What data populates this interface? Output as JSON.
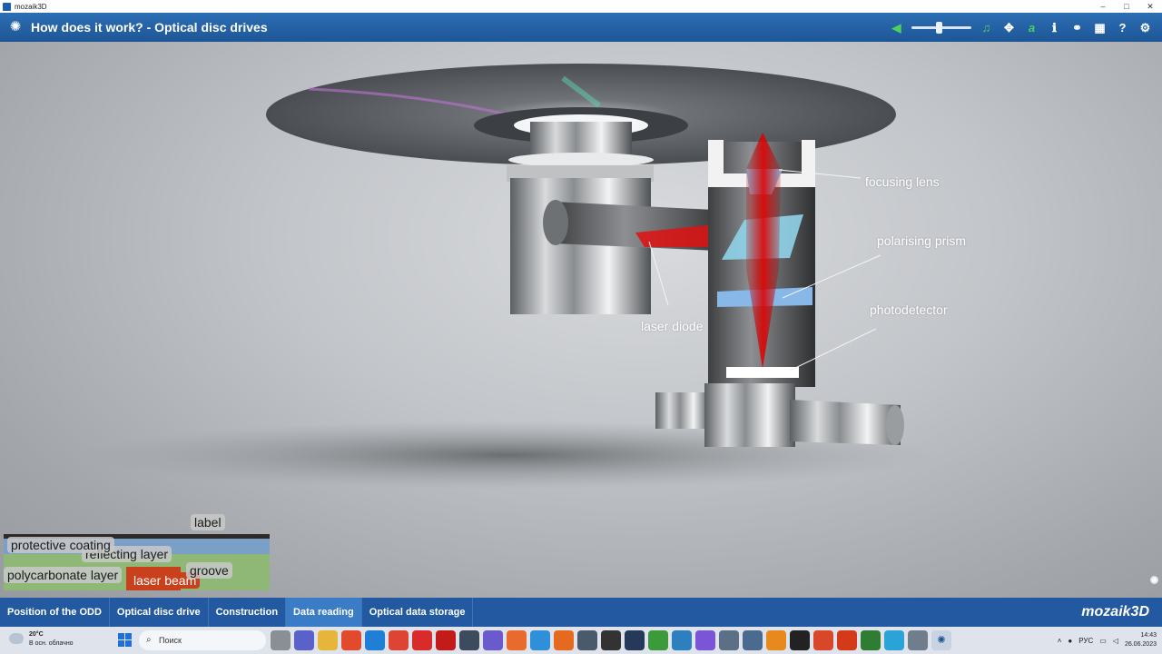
{
  "window": {
    "title": "mozaik3D",
    "min": "–",
    "max": "□",
    "close": "✕"
  },
  "header": {
    "title": "How does it work? - Optical disc drives",
    "tools": [
      {
        "name": "volume-icon",
        "glyph": "◀"
      },
      {
        "name": "music-icon",
        "glyph": "♫"
      },
      {
        "name": "move-icon",
        "glyph": "✥"
      },
      {
        "name": "text-label-icon",
        "glyph": "a"
      },
      {
        "name": "info-icon",
        "glyph": "ℹ"
      },
      {
        "name": "link-icon",
        "glyph": "⚭"
      },
      {
        "name": "grid-icon",
        "glyph": "▦"
      },
      {
        "name": "help-icon",
        "glyph": "?"
      },
      {
        "name": "settings-icon",
        "glyph": "⚙"
      }
    ],
    "volume_level": 0.45
  },
  "scene": {
    "labels": {
      "focusing_lens": "focusing lens",
      "polarising_prism": "polarising prism",
      "photodetector": "photodetector",
      "laser_diode": "laser diode"
    }
  },
  "legend": {
    "label": "label",
    "protective_coating": "protective coating",
    "reflecting_layer": "reflecting layer",
    "polycarbonate_layer": "polycarbonate layer",
    "laser_beam": "laser beam",
    "groove": "groove"
  },
  "nav": {
    "tabs": [
      {
        "label": "Position of the ODD",
        "active": false
      },
      {
        "label": "Optical disc drive",
        "active": false
      },
      {
        "label": "Construction",
        "active": false
      },
      {
        "label": "Data reading",
        "active": true
      },
      {
        "label": "Optical data storage",
        "active": false
      }
    ],
    "brand": "mozaik3D"
  },
  "taskbar": {
    "weather_temp": "20°C",
    "weather_desc": "В осн. облачно",
    "search_placeholder": "Поиск",
    "language": "РУС",
    "time": "14:43",
    "date": "26.06.2023"
  },
  "colors": {
    "header": "#1d5696",
    "nav": "#2259a0",
    "nav_active": "#3a7cc6",
    "laser": "#c8401c"
  }
}
